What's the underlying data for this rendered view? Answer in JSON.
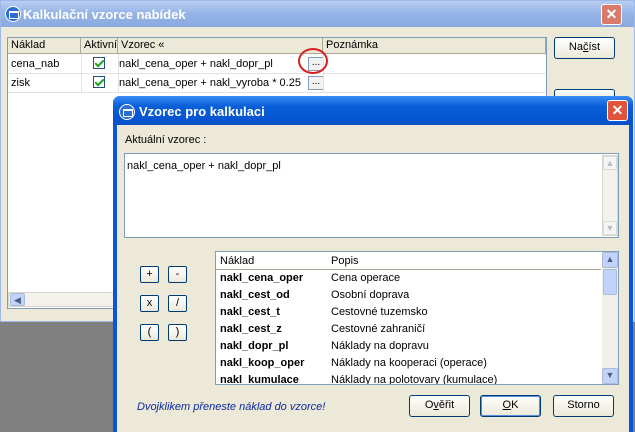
{
  "bg_window": {
    "title": "Kalkulační vzorce nabídek",
    "columns": [
      "Náklad",
      "Aktivní",
      "Vzorec «",
      "Poznámka"
    ],
    "rows": [
      {
        "naklad": "cena_nab",
        "aktivni": true,
        "vzorec": "nakl_cena_oper + nakl_dopr_pl",
        "poznamka": ""
      },
      {
        "naklad": "zisk",
        "aktivni": true,
        "vzorec": "nakl_cena_oper + nakl_vyroba  * 0.25",
        "poznamka": ""
      }
    ],
    "ellipsis_label": "...",
    "nacist_label": "Načíst",
    "nacist_prefix": "Na",
    "nacist_underlined": "č",
    "nacist_suffix": "íst"
  },
  "dialog": {
    "title": "Vzorec pro kalkulaci",
    "current_formula_label": "Aktuální vzorec :",
    "formula_value": "nakl_cena_oper + nakl_dopr_pl",
    "operators": [
      "+",
      "-",
      "x",
      "/",
      "(",
      ")"
    ],
    "list_columns": [
      "Náklad",
      "Popis"
    ],
    "list_items": [
      {
        "naklad": "nakl_cena_oper",
        "popis": "Cena operace"
      },
      {
        "naklad": "nakl_cest_od",
        "popis": "Osobní doprava"
      },
      {
        "naklad": "nakl_cest_t",
        "popis": "Cestovné tuzemsko"
      },
      {
        "naklad": "nakl_cest_z",
        "popis": "Cestovné zahraničí"
      },
      {
        "naklad": "nakl_dopr_pl",
        "popis": "Náklady na dopravu"
      },
      {
        "naklad": "nakl_koop_oper",
        "popis": "Náklady na kooperaci (operace)"
      },
      {
        "naklad": "nakl_kumulace",
        "popis": "Náklady na polotovary (kumulace)"
      }
    ],
    "hint": "Dvojklikem přeneste náklad do vzorce!",
    "buttons": {
      "overit_prefix": "O",
      "overit_underlined": "v",
      "overit_suffix": "ěřit",
      "ok_prefix": "",
      "ok_underlined": "O",
      "ok_suffix": "K",
      "storno": "Storno"
    }
  },
  "colors": {
    "title_active": "#0a5fd8",
    "title_inactive": "#9db9eb",
    "highlight_circle": "#d81f1f",
    "hint_text": "#0b2a9e"
  }
}
